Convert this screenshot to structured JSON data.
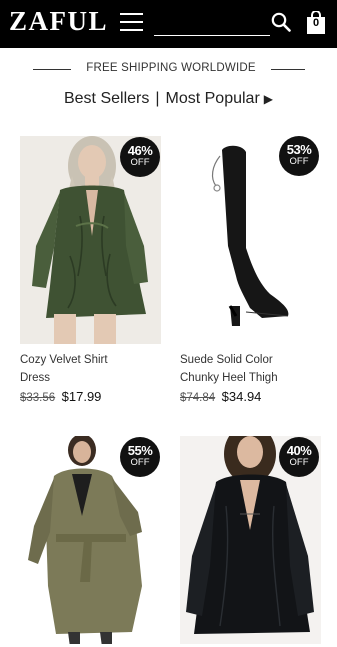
{
  "header": {
    "logo": "ZAFUL",
    "search_value": "",
    "cart_count": "0"
  },
  "banner": {
    "shipping_text": "FREE SHIPPING WORLDWIDE"
  },
  "section": {
    "tab_best": "Best Sellers",
    "separator": "|",
    "tab_popular": "Most Popular",
    "arrow": "▶"
  },
  "products": [
    {
      "name": "Cozy Velvet Shirt Dress",
      "old_price": "$33.56",
      "price": "$17.99",
      "discount": "46%",
      "off_label": "OFF"
    },
    {
      "name": "Suede Solid Color Chunky Heel Thigh",
      "old_price": "$74.84",
      "price": "$34.94",
      "discount": "53%",
      "off_label": "OFF"
    },
    {
      "name": "",
      "old_price": "",
      "price": "",
      "discount": "55%",
      "off_label": "OFF"
    },
    {
      "name": "",
      "old_price": "",
      "price": "",
      "discount": "40%",
      "off_label": "OFF"
    }
  ],
  "colors": {
    "header_bg": "#000000",
    "badge_bg": "#111111",
    "velvet_green": "#3f5233",
    "olive_coat": "#7c7a58"
  }
}
